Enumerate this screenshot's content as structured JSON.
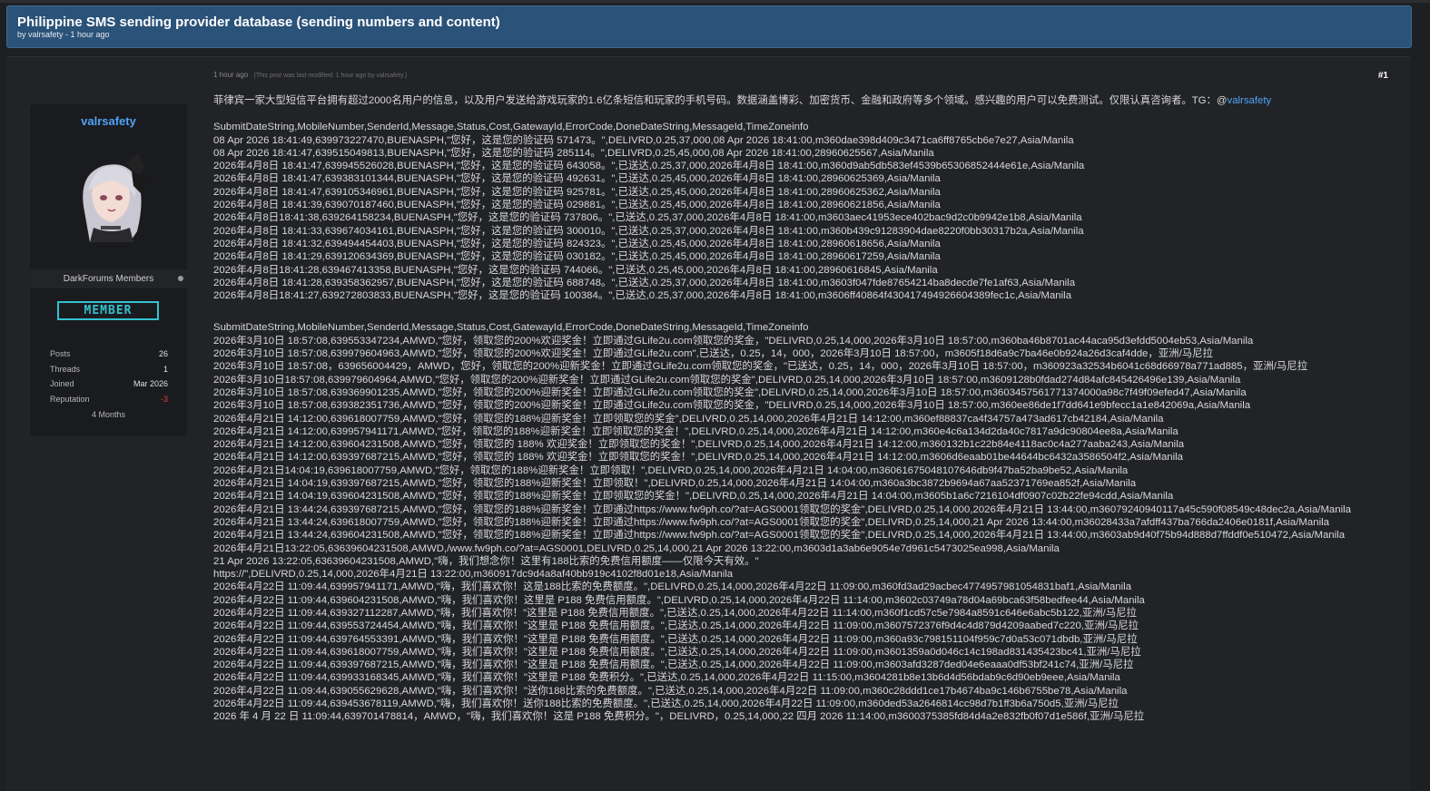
{
  "thread": {
    "title": "Philippine SMS sending provider database (sending numbers and content)",
    "meta": "by valrsafety - 1 hour ago"
  },
  "user": {
    "name": "valrsafety",
    "group": "DarkForums Members",
    "badge": "MEMBER",
    "stats": [
      {
        "label": "Posts",
        "value": "26"
      },
      {
        "label": "Threads",
        "value": "1"
      },
      {
        "label": "Joined",
        "value": "Mar 2026"
      },
      {
        "label": "Reputation",
        "value": "-3"
      }
    ],
    "tenure": "4 Months"
  },
  "post": {
    "time": "1 hour ago",
    "edited": "(This post was last modified: 1 hour ago by valrsafety.)",
    "number": "#1",
    "intro": "菲律宾一家大型短信平台拥有超过2000名用户的信息，以及用户发送给游戏玩家的1.6亿条短信和玩家的手机号码。数据涵盖博彩、加密货币、金融和政府等多个领域。感兴趣的用户可以免费测试。仅限认真咨询者。TG：@",
    "tg_handle": "valrsafety",
    "block1": [
      "SubmitDateString,MobileNumber,SenderId,Message,Status,Cost,GatewayId,ErrorCode,DoneDateString,MessageId,TimeZoneinfo",
      "08 Apr 2026 18:41:49,639973227470,BUENASPH,\"您好，这是您的验证码 571473。\",DELIVRD,0.25,37,000,08 Apr 2026 18:41:00,m360dae398d409c3471ca6ff8765cb6e7e27,Asia/Manila",
      "08 Apr 2026 18:41:47,639515049813,BUENASPH,\"您好，这是您的验证码 285114。\",DELIVRD,0.25,45,000,08 Apr 2026 18:41:00,28960625567,Asia/Manila",
      "2026年4月8日 18:41:47,639945526028,BUENASPH,\"您好，这是您的验证码 643058。\",已送达,0.25,37,000,2026年4月8日 18:41:00,m360d9ab5db583ef4539b65306852444e61e,Asia/Manila",
      "2026年4月8日 18:41:47,639383101344,BUENASPH,\"您好，这是您的验证码 492631。\",已送达,0.25,45,000,2026年4月8日 18:41:00,28960625369,Asia/Manila",
      "2026年4月8日 18:41:47,639105346961,BUENASPH,\"您好，这是您的验证码 925781。\",已送达,0.25,45,000,2026年4月8日 18:41:00,28960625362,Asia/Manila",
      "2026年4月8日 18:41:39,639070187460,BUENASPH,\"您好，这是您的验证码 029881。\",已送达,0.25,45,000,2026年4月8日 18:41:00,28960621856,Asia/Manila",
      "2026年4月8日18:41:38,639264158234,BUENASPH,\"您好，这是您的验证码 737806。\",已送达,0.25,37,000,2026年4月8日 18:41:00,m3603aec41953ece402bac9d2c0b9942e1b8,Asia/Manila",
      "2026年4月8日 18:41:33,639674034161,BUENASPH,\"您好，这是您的验证码 300010。\",已送达,0.25,37,000,2026年4月8日 18:41:00,m360b439c91283904dae8220f0bb30317b2a,Asia/Manila",
      "2026年4月8日 18:41:32,639494454403,BUENASPH,\"您好，这是您的验证码 824323。\",已送达,0.25,45,000,2026年4月8日 18:41:00,28960618656,Asia/Manila",
      "2026年4月8日 18:41:29,639120634369,BUENASPH,\"您好，这是您的验证码 030182。\",已送达,0.25,45,000,2026年4月8日 18:41:00,28960617259,Asia/Manila",
      "2026年4月8日18:41:28,639467413358,BUENASPH,\"您好，这是您的验证码 744066。\",已送达,0.25,45,000,2026年4月8日 18:41:00,28960616845,Asia/Manila",
      "2026年4月8日 18:41:28,639358362957,BUENASPH,\"您好，这是您的验证码 688748。\",已送达,0.25,37,000,2026年4月8日 18:41:00,m3603f047fde87654214ba8decde7fe1af63,Asia/Manila",
      "2026年4月8日18:41:27,639272803833,BUENASPH,\"您好，这是您的验证码 100384。\",已送达,0.25,37,000,2026年4月8日 18:41:00,m3606ff40864f430417494926604389fec1c,Asia/Manila"
    ],
    "block2": [
      "SubmitDateString,MobileNumber,SenderId,Message,Status,Cost,GatewayId,ErrorCode,DoneDateString,MessageId,TimeZoneinfo",
      "2026年3月10日 18:57:08,639553347234,AMWD,\"您好，领取您的200%欢迎奖金！立即通过GLife2u.com领取您的奖金，\"DELIVRD,0.25,14,000,2026年3月10日 18:57:00,m360ba46b8701ac44aca95d3efdd5004eb53,Asia/Manila",
      "2026年3月10日 18:57:08,639979604963,AMWD,\"您好，领取您的200%欢迎奖金！立即通过GLife2u.com\",已送达，0.25，14，000，2026年3月10日 18:57:00，m3605f18d6a9c7ba46e0b924a26d3caf4dde，亚洲/马尼拉",
      "2026年3月10日 18:57:08，639656004429，AMWD，您好，领取您的200%迎新奖金！立即通过GLife2u.com领取您的奖金，\"已送达，0.25，14，000，2026年3月10日 18:57:00，m360923a32534b6041c68d66978a771ad885，亚洲/马尼拉",
      "2026年3月10日18:57:08,639979604964,AMWD,\"您好，领取您的200%迎新奖金！立即通过GLife2u.com领取您的奖金\",DELIVRD,0.25,14,000,2026年3月10日 18:57:00,m3609128b0fdad274d84afc845426496e139,Asia/Manila",
      "2026年3月10日 18:57:08,639369901235,AMWD,\"您好，领取您的200%迎新奖金！立即通过GLife2u.com领取您的奖金\",DELIVRD,0.25,14,000,2026年3月10日 18:57:00,m3603457561771374000a98c7f49f09efed47,Asia/Manila",
      "2026年3月10日 18:57:08,639382351736,AMWD,\"您好，领取您的200%迎新奖金！立即通过GLife2u.com领取您的奖金，\"DELIVRD,0.25,14,000,2026年3月10日 18:57:00,m360ee86de1f7dd641e9bfecc1a1e842069a,Asia/Manila",
      "2026年4月21日 14:12:00,639618007759,AMWD,\"您好，领取您的188%迎新奖金！立即领取您的奖金\",DELIVRD,0.25,14,000,2026年4月21日 14:12:00,m360ef88837ca4f34757a473ad617cb42184,Asia/Manila",
      "2026年4月21日 14:12:00,639957941171,AMWD,\"您好，领取您的188%迎新奖金！立即领取您的奖金！\",DELIVRD,0.25,14,000,2026年4月21日 14:12:00,m360e4c6a134d2da40c7817a9dc90804ee8a,Asia/Manila",
      "2026年4月21日 14:12:00,639604231508,AMWD,\"您好，领取您的 188% 欢迎奖金！立即领取您的奖金！\",DELIVRD,0.25,14,000,2026年4月21日 14:12:00,m360132b1c22b84e4118ac0c4a277aaba243,Asia/Manila",
      "2026年4月21日 14:12:00,639397687215,AMWD,\"您好，领取您的 188% 欢迎奖金！立即领取您的奖金！\",DELIVRD,0.25,14,000,2026年4月21日 14:12:00,m3606d6eaab01be44644bc6432a3586504f2,Asia/Manila",
      "2026年4月21日14:04:19,639618007759,AMWD,\"您好，领取您的188%迎新奖金！立即领取！\",DELIVRD,0.25,14,000,2026年4月21日 14:04:00,m36061675048107646db9f47ba52ba9be52,Asia/Manila",
      "2026年4月21日 14:04:19,639397687215,AMWD,\"您好，领取您的188%迎新奖金！立即领取！\",DELIVRD,0.25,14,000,2026年4月21日 14:04:00,m360a3bc3872b9694a67aa52371769ea852f,Asia/Manila",
      "2026年4月21日 14:04:19,639604231508,AMWD,\"您好，领取您的188%迎新奖金！立即领取您的奖金！\",DELIVRD,0.25,14,000,2026年4月21日 14:04:00,m3605b1a6c7216104df0907c02b22fe94cdd,Asia/Manila",
      "2026年4月21日 13:44:24,639397687215,AMWD,\"您好，领取您的188%迎新奖金！立即通过https://www.fw9ph.co/?at=AGS0001领取您的奖金\",DELIVRD,0.25,14,000,2026年4月21日 13:44:00,m36079240940117a45c590f08549c48dec2a,Asia/Manila",
      "2026年4月21日 13:44:24,639618007759,AMWD,\"您好，领取您的188%迎新奖金！立即通过https://www.fw9ph.co/?at=AGS0001领取您的奖金\",DELIVRD,0.25,14,000,21 Apr 2026 13:44:00,m36028433a7afdff437ba766da2406e0181f,Asia/Manila",
      "2026年4月21日 13:44:24,639604231508,AMWD,\"您好，领取您的188%迎新奖金！立即通过https://www.fw9ph.co/?at=AGS0001领取您的奖金\",DELIVRD,0.25,14,000,2026年4月21日 13:44:00,m3603ab9d40f75b94d888d7ffddf0e510472,Asia/Manila",
      "2026年4月21日13:22:05,63639604231508,AMWD,/www.fw9ph.co/?at=AGS0001,DELIVRD,0.25,14,000,21 Apr 2026 13:22:00,m3603d1a3ab6e9054e7d961c5473025ea998,Asia/Manila",
      "21 Apr 2026 13:22:05,63639604231508,AMWD,\"嗨，我们想念你！这里有188比索的免费信用额度——仅限今天有效。\"",
      "https://\",DELIVRD,0.25,14,000,2026年4月21日 13:22:00,m360917dc9d4a8af40bb919c4102f8d01e18,Asia/Manila",
      "2026年4月22日 11:09:44,639957941171,AMWD,\"嗨，我们喜欢你！这是188比索的免费额度。\",DELIVRD,0.25,14,000,2026年4月22日 11:09:00,m360fd3ad29acbec4774957981054831baf1,Asia/Manila",
      "2026年4月22日 11:09:44,639604231508,AMWD,\"嗨，我们喜欢你！这里是 P188 免费信用额度。\",DELIVRD,0.25,14,000,2026年4月22日 11:14:00,m3602c03749a78d04a69bca63f58bedfee44,Asia/Manila",
      "2026年4月22日 11:09:44,639327112287,AMWD,\"嗨，我们喜欢你！\"这里是 P188 免费信用额度。\",已送达,0.25,14,000,2026年4月22日 11:14:00,m360f1cd57c5e7984a8591c646e6abc5b122,亚洲/马尼拉",
      "2026年4月22日 11:09:44,639553724454,AMWD,\"嗨，我们喜欢你！\"这里是 P188 免费信用额度。\",已送达,0.25,14,000,2026年4月22日 11:09:00,m3607572376f9d4c4d879d4209aabed7c220,亚洲/马尼拉",
      "2026年4月22日 11:09:44,639764553391,AMWD,\"嗨，我们喜欢你！\"这里是 P188 免费信用额度。\",已送达,0.25,14,000,2026年4月22日 11:09:00,m360a93c798151104f959c7d0a53c071dbdb,亚洲/马尼拉",
      "2026年4月22日 11:09:44,639618007759,AMWD,\"嗨，我们喜欢你！\"这里是 P188 免费信用额度。\",已送达,0.25,14,000,2026年4月22日 11:09:00,m3601359a0d046c14c198ad831435423bc41,亚洲/马尼拉",
      "2026年4月22日 11:09:44,639397687215,AMWD,\"嗨，我们喜欢你！\"这里是 P188 免费信用额度。\",已送达,0.25,14,000,2026年4月22日 11:09:00,m3603afd3287ded04e6eaaa0df53bf241c74,亚洲/马尼拉",
      "2026年4月22日 11:09:44,639933168345,AMWD,\"嗨，我们喜欢你！\"这里是 P188 免费积分。\",已送达,0.25,14,000,2026年4月22日 11:15:00,m3604281b8e13b6d4d56bdab9c6d90eb9eee,Asia/Manila",
      "2026年4月22日 11:09:44,639055629628,AMWD,\"嗨，我们喜欢你！\"送你188比索的免费额度。\",已送达,0.25,14,000,2026年4月22日 11:09:00,m360c28ddd1ce17b4674ba9c146b6755be78,Asia/Manila",
      "2026年4月22日 11:09:44,639453678119,AMWD,\"嗨，我们喜欢你！送你188比索的免费额度。\",已送达,0.25,14,000,2026年4月22日 11:09:00,m360ded53a2646814cc98d7b1ff3b6a750d5,亚洲/马尼拉",
      "2026 年 4 月 22 日 11:09:44,639701478814，AMWD，\"嗨，我们喜欢你！这是 P188 免费积分。\"，DELIVRD，0.25,14,000,22 四月 2026 11:14:00,m3600375385fd84d4a2e832fb0f07d1e586f,亚洲/马尼拉"
    ]
  }
}
